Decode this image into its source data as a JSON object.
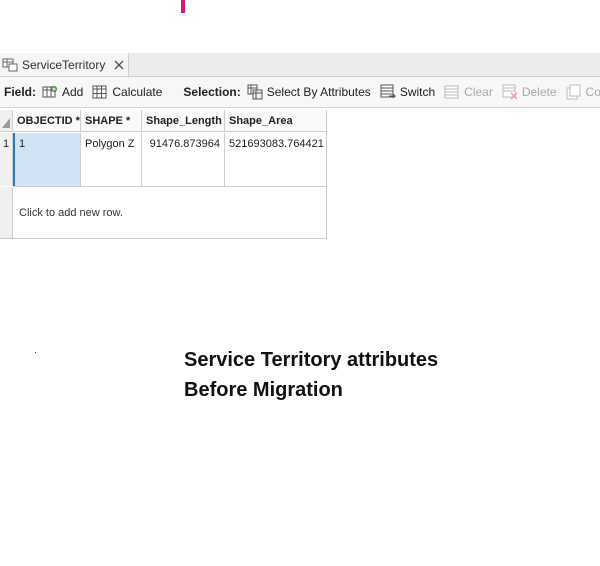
{
  "tab": {
    "title": "ServiceTerritory",
    "icon": "table-icon",
    "close_icon": "close-icon"
  },
  "toolbar": {
    "field_label": "Field:",
    "add_label": "Add",
    "calculate_label": "Calculate",
    "selection_label": "Selection:",
    "select_by_attributes_label": "Select By Attributes",
    "switch_label": "Switch",
    "clear_label": "Clear",
    "delete_label": "Delete",
    "copy_label": "Copy"
  },
  "table": {
    "columns": [
      "OBJECTID *",
      "SHAPE *",
      "Shape_Length",
      "Shape_Area"
    ],
    "rows": [
      {
        "row_number": "1",
        "cells": [
          "1",
          "Polygon Z",
          "91476.873964",
          "521693083.764421"
        ]
      }
    ],
    "new_row_text": "Click to add new row."
  },
  "caption": {
    "line1": "Service Territory attributes",
    "line2": "Before Migration"
  },
  "colors": {
    "accent": "#d4187c",
    "selection": "#cfe3f5",
    "selection_border": "#2a78c8"
  }
}
